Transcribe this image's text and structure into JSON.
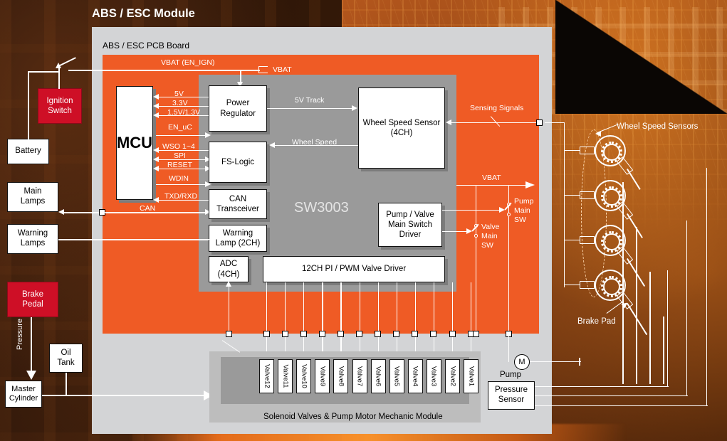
{
  "page_title": "ABS / ESC Module",
  "pcb_board_label": "ABS / ESC PCB Board",
  "chip": {
    "name": "SW3003"
  },
  "colors": {
    "pcb_orange": "#ef5b25",
    "chip_gray": "#9a9a9a",
    "board_gray": "#d3d4d6",
    "red_box": "#ce0f26",
    "wire_white": "#ffffff"
  },
  "external_blocks": [
    {
      "name": "ignition-switch",
      "label": "Ignition\nSwitch",
      "style": "red"
    },
    {
      "name": "battery",
      "label": "Battery",
      "style": "white"
    },
    {
      "name": "main-lamps",
      "label": "Main\nLamps",
      "style": "white"
    },
    {
      "name": "warning-lamps",
      "label": "Warning\nLamps",
      "style": "white"
    },
    {
      "name": "brake-pedal",
      "label": "Brake\nPedal",
      "style": "red"
    },
    {
      "name": "oil-tank",
      "label": "Oil\nTank",
      "style": "white"
    },
    {
      "name": "master-cylinder",
      "label": "Master\nCylinder",
      "style": "white"
    }
  ],
  "external_labels": {
    "pressure": "Pressure",
    "wheel_speed_sensors": "Wheel Speed Sensors",
    "brake_pad": "Brake Pad",
    "pump": "Pump",
    "pump_motor_symbol": "M",
    "pressure_sensor": "Pressure\nSensor"
  },
  "mcu": {
    "label": "MCU"
  },
  "chip_blocks": [
    {
      "name": "power-regulator",
      "label": "Power\nRegulator"
    },
    {
      "name": "fs-logic",
      "label": "FS-Logic"
    },
    {
      "name": "can-transceiver",
      "label": "CAN\nTransceiver"
    },
    {
      "name": "warning-lamp-2ch",
      "label": "Warning\nLamp (2CH)"
    },
    {
      "name": "adc-4ch",
      "label": "ADC\n(4CH)"
    },
    {
      "name": "valve-driver",
      "label": "12CH PI / PWM Valve Driver"
    },
    {
      "name": "wheel-speed-sensor-4ch",
      "label": "Wheel Speed Sensor\n(4CH)"
    },
    {
      "name": "pump-valve-main-switch-driver",
      "label": "Pump / Valve\nMain Switch\nDriver"
    }
  ],
  "signals": {
    "vbat_en_ign": "VBAT (EN_IGN)",
    "vbat": "VBAT",
    "vbat2": "VBAT",
    "v5": "5V",
    "v33": "3.3V",
    "v15_13": "1.5V/1.3V",
    "en_uc": "EN_uC",
    "wso": "WSO 1~4",
    "spi": "SPI",
    "reset": "RESET",
    "wdin": "WDIN",
    "txd_rxd": "TXD/RXD",
    "can": "CAN",
    "track_5v": "5V Track",
    "wheel_speed": "Wheel Speed",
    "sensing_signals": "Sensing Signals",
    "pump_main_sw": "Pump\nMain\nSW",
    "valve_main_sw": "Valve\nMain\nSW"
  },
  "valve_module": {
    "title": "Solenoid Valves & Pump Motor Mechanic Module",
    "valves": [
      "Valve12",
      "Valve11",
      "Valve10",
      "Valve9",
      "Valve8",
      "Valve7",
      "Valve6",
      "Valve5",
      "Valve4",
      "Valve3",
      "Valve2",
      "Valve1"
    ]
  }
}
